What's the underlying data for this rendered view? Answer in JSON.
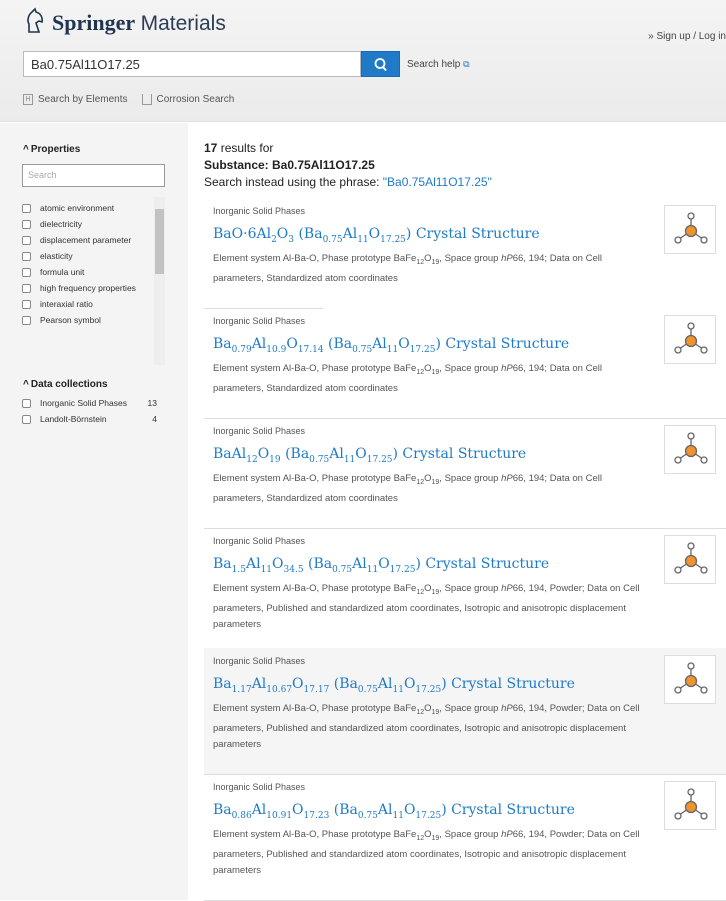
{
  "header": {
    "brand": "Springer",
    "brand2": "Materials",
    "signup": "» Sign up / Log in",
    "query": "Ba0.75Al11O17.25",
    "search_help": "Search help",
    "search_by_elements": "Search by Elements",
    "corrosion_search": "Corrosion Search"
  },
  "sidebar": {
    "properties_title": "Properties",
    "search_placeholder": "Search",
    "properties": [
      "atomic environment",
      "dielectricity",
      "displacement parameter",
      "elasticity",
      "formula unit",
      "high frequency properties",
      "interaxial ratio",
      "Pearson symbol"
    ],
    "collections_title": "Data collections",
    "collections": [
      {
        "label": "Inorganic Solid Phases",
        "count": "13"
      },
      {
        "label": "Landolt-Börnstein",
        "count": "4"
      }
    ]
  },
  "results": {
    "count": "17",
    "results_for": " results for",
    "substance": "Substance: Ba0.75Al11O17.25",
    "instead": "Search instead using the phrase: ",
    "phrase": "\"Ba0.75Al11O17.25\"",
    "items": [
      {
        "category": "Inorganic Solid Phases",
        "title": [
          [
            "BaO·6Al",
            ""
          ],
          [
            "",
            "2"
          ],
          [
            "O",
            ""
          ],
          [
            "",
            "3"
          ],
          [
            " (Ba",
            ""
          ],
          [
            "",
            "0.75"
          ],
          [
            "Al",
            ""
          ],
          [
            "",
            "11"
          ],
          [
            "O",
            ""
          ],
          [
            "",
            "17.25"
          ],
          [
            ") Crystal Structure",
            ""
          ]
        ],
        "desc": "Element system Al-Ba-O, Phase prototype BaFe12O19, Space group hP66, 194; Data on Cell parameters, Standardized atom coordinates"
      },
      {
        "category": "Inorganic Solid Phases",
        "title": [
          [
            "Ba",
            ""
          ],
          [
            "",
            "0.79"
          ],
          [
            "Al",
            ""
          ],
          [
            "",
            "10.9"
          ],
          [
            "O",
            ""
          ],
          [
            "",
            "17.14"
          ],
          [
            " (Ba",
            ""
          ],
          [
            "",
            "0.75"
          ],
          [
            "Al",
            ""
          ],
          [
            "",
            "11"
          ],
          [
            "O",
            ""
          ],
          [
            "",
            "17.25"
          ],
          [
            ") Crystal Structure",
            ""
          ]
        ],
        "desc": "Element system Al-Ba-O, Phase prototype BaFe12O19, Space group hP66, 194; Data on Cell parameters, Standardized atom coordinates"
      },
      {
        "category": "Inorganic Solid Phases",
        "title": [
          [
            "BaAl",
            ""
          ],
          [
            "",
            "12"
          ],
          [
            "O",
            ""
          ],
          [
            "",
            "19"
          ],
          [
            " (Ba",
            ""
          ],
          [
            "",
            "0.75"
          ],
          [
            "Al",
            ""
          ],
          [
            "",
            "11"
          ],
          [
            "O",
            ""
          ],
          [
            "",
            "17.25"
          ],
          [
            ") Crystal Structure",
            ""
          ]
        ],
        "desc": "Element system Al-Ba-O, Phase prototype BaFe12O19, Space group hP66, 194; Data on Cell parameters, Standardized atom coordinates"
      },
      {
        "category": "Inorganic Solid Phases",
        "title": [
          [
            "Ba",
            ""
          ],
          [
            "",
            "1.5"
          ],
          [
            "Al",
            ""
          ],
          [
            "",
            "11"
          ],
          [
            "O",
            ""
          ],
          [
            "",
            "34.5"
          ],
          [
            " (Ba",
            ""
          ],
          [
            "",
            "0.75"
          ],
          [
            "Al",
            ""
          ],
          [
            "",
            "11"
          ],
          [
            "O",
            ""
          ],
          [
            "",
            "17.25"
          ],
          [
            ") Crystal Structure",
            ""
          ]
        ],
        "desc": "Element system Al-Ba-O, Phase prototype BaFe12O19, Space group hP66, 194, Powder; Data on Cell parameters, Published and standardized atom coordinates, Isotropic and anisotropic displacement parameters"
      },
      {
        "category": "Inorganic Solid Phases",
        "title": [
          [
            "Ba",
            ""
          ],
          [
            "",
            "1.17"
          ],
          [
            "Al",
            ""
          ],
          [
            "",
            "10.67"
          ],
          [
            "O",
            ""
          ],
          [
            "",
            "17.17"
          ],
          [
            " (Ba",
            ""
          ],
          [
            "",
            "0.75"
          ],
          [
            "Al",
            ""
          ],
          [
            "",
            "11"
          ],
          [
            "O",
            ""
          ],
          [
            "",
            "17.25"
          ],
          [
            ") Crystal Structure",
            ""
          ]
        ],
        "desc": "Element system Al-Ba-O, Phase prototype BaFe12O19, Space group hP66, 194, Powder; Data on Cell parameters, Published and standardized atom coordinates, Isotropic and anisotropic displacement parameters"
      },
      {
        "category": "Inorganic Solid Phases",
        "title": [
          [
            "Ba",
            ""
          ],
          [
            "",
            "0.86"
          ],
          [
            "Al",
            ""
          ],
          [
            "",
            "10.91"
          ],
          [
            "O",
            ""
          ],
          [
            "",
            "17.23"
          ],
          [
            " (Ba",
            ""
          ],
          [
            "",
            "0.75"
          ],
          [
            "Al",
            ""
          ],
          [
            "",
            "11"
          ],
          [
            "O",
            ""
          ],
          [
            "",
            "17.25"
          ],
          [
            ") Crystal Structure",
            ""
          ]
        ],
        "desc": "Element system Al-Ba-O, Phase prototype BaFe12O19, Space group hP66, 194, Powder; Data on Cell parameters, Published and standardized atom coordinates, Isotropic and anisotropic displacement parameters"
      }
    ]
  },
  "colors": {
    "accent": "#1f7ac7",
    "orange": "#f0932e"
  }
}
